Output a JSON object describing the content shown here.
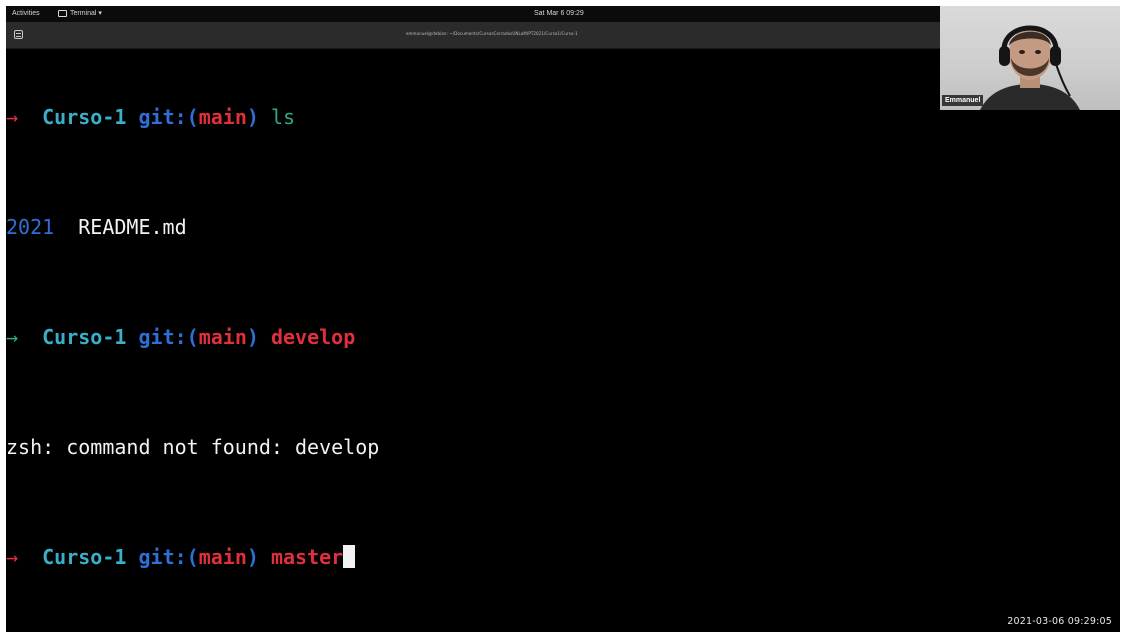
{
  "topbar": {
    "activities": "Activities",
    "app_menu": "Terminal ▾",
    "clock": "Sat Mar 6  09:29"
  },
  "terminal_window": {
    "title": "emmanuel@debian: ~/Documents/CursosCerradosUNLaM/PT2021/Curso1/Curso-1"
  },
  "terminal": {
    "line1": {
      "arrow": "→",
      "dir": "Curso-1",
      "git_open": "git:(",
      "branch": "main",
      "git_close": ")",
      "command": "ls"
    },
    "line2": {
      "folder": "2021",
      "file": "README.md"
    },
    "line3": {
      "arrow": "→",
      "dir": "Curso-1",
      "git_open": "git:(",
      "branch": "main",
      "git_close": ")",
      "command": "develop"
    },
    "line4": {
      "output": "zsh: command not found: develop"
    },
    "line5": {
      "arrow": "→",
      "dir": "Curso-1",
      "git_open": "git:(",
      "branch": "main",
      "git_close": ")",
      "command": "master"
    }
  },
  "webcam": {
    "name": "Emmanuel"
  },
  "recording": {
    "timestamp": "2021-03-06  09:29:05"
  },
  "colors": {
    "background": "#000000",
    "arrow_error": "#e0303c",
    "arrow_ok": "#2fa98a",
    "directory": "#3ab0c8",
    "git": "#2f6fd6",
    "branch": "#e0303c",
    "text": "#f2f2f2"
  }
}
